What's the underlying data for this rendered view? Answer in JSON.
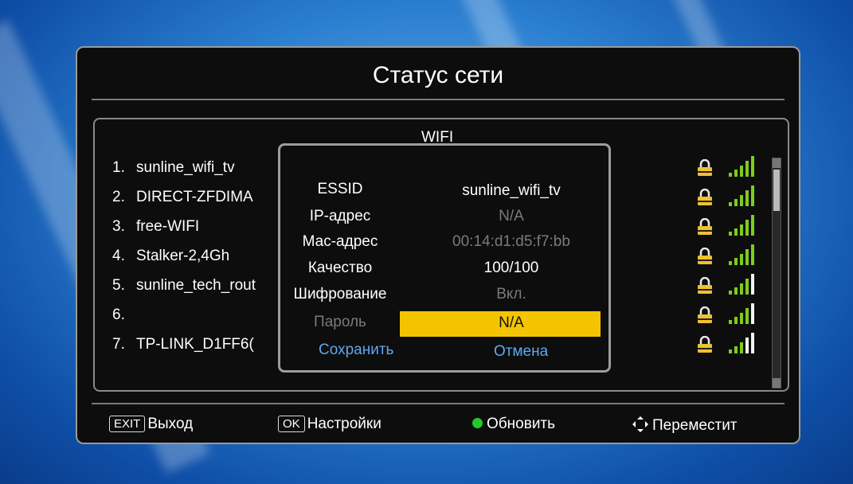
{
  "title": "Статус сети",
  "list_header": "WIFI",
  "networks": [
    {
      "num": "1.",
      "name": "sunline_wifi_tv"
    },
    {
      "num": "2.",
      "name": "DIRECT-ZFDIMA"
    },
    {
      "num": "3.",
      "name": "free-WIFI"
    },
    {
      "num": "4.",
      "name": "Stalker-2,4Gh"
    },
    {
      "num": "5.",
      "name": "sunline_tech_rout"
    },
    {
      "num": "6.",
      "name": ""
    },
    {
      "num": "7.",
      "name": "TP-LINK_D1FF6("
    }
  ],
  "dialog": {
    "essid_label": "ESSID",
    "essid_value": "sunline_wifi_tv",
    "ip_label": "IP-адрес",
    "ip_value": "N/A",
    "mac_label": "Мас-адрес",
    "mac_value": "00:14:d1:d5:f7:bb",
    "quality_label": "Качество",
    "quality_value": "100/100",
    "encryption_label": "Шифрование",
    "encryption_value": "Вкл.",
    "password_label": "Пароль",
    "password_value": "N/A",
    "save_label": "Сохранить",
    "cancel_label": "Отмена"
  },
  "footer": {
    "exit_key": "EXIT",
    "exit_label": "Выход",
    "ok_key": "OK",
    "ok_label": "Настройки",
    "refresh_label": "Обновить",
    "move_label": "Переместит"
  },
  "colors": {
    "highlight": "#f5c400",
    "signal": "#7ccd1a",
    "lock": "#f0c030",
    "button_text": "#5fa8f0"
  },
  "icons": [
    "lock-icon",
    "signal-strength-icon",
    "green-dot-icon",
    "navigation-arrows-icon"
  ]
}
